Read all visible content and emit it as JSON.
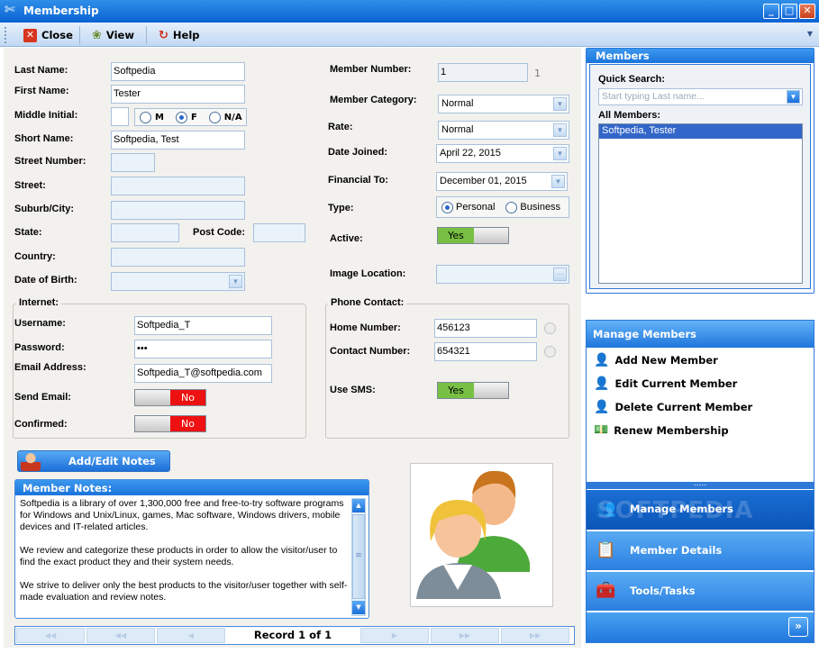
{
  "window": {
    "title": "Membership"
  },
  "toolbar": {
    "close": "Close",
    "view": "View",
    "help": "Help"
  },
  "form": {
    "last_name_label": "Last Name:",
    "last_name": "Softpedia",
    "first_name_label": "First Name:",
    "first_name": "Tester",
    "middle_initial_label": "Middle Initial:",
    "middle_initial": "",
    "gender_m": "M",
    "gender_f": "F",
    "gender_na": "N/A",
    "short_name_label": "Short Name:",
    "short_name": "Softpedia, Test",
    "street_number_label": "Street Number:",
    "street_label": "Street:",
    "suburb_label": "Suburb/City:",
    "state_label": "State:",
    "post_code_label": "Post Code:",
    "country_label": "Country:",
    "dob_label": "Date of Birth:",
    "member_number_label": "Member Number:",
    "member_number": "1",
    "member_number_side": "1",
    "category_label": "Member Category:",
    "category": "Normal",
    "rate_label": "Rate:",
    "rate": "Normal",
    "date_joined_label": "Date Joined:",
    "date_joined": "April 22, 2015",
    "financial_to_label": "Financial To:",
    "financial_to": "December 01, 2015",
    "type_label": "Type:",
    "type_personal": "Personal",
    "type_business": "Business",
    "active_label": "Active:",
    "active": "Yes",
    "image_location_label": "Image Location:"
  },
  "internet": {
    "title": "Internet:",
    "username_label": "Username:",
    "username": "Softpedia_T",
    "password_label": "Password:",
    "password": "•••",
    "email_label": "Email Address:",
    "email": "Softpedia_T@softpedia.com",
    "send_email_label": "Send Email:",
    "send_email": "No",
    "confirmed_label": "Confirmed:",
    "confirmed": "No"
  },
  "phone": {
    "title": "Phone Contact:",
    "home_label": "Home Number:",
    "home": "456123",
    "contact_label": "Contact Number:",
    "contact": "654321",
    "sms_label": "Use SMS:",
    "sms": "Yes"
  },
  "notes": {
    "button": "Add/Edit Notes",
    "title": "Member Notes:",
    "p1": "Softpedia is a library of over 1,300,000 free and free-to-try software programs for Windows and Unix/Linux, games, Mac software, Windows drivers, mobile devices and IT-related articles.",
    "p2": "We review and categorize these products in order to allow the visitor/user to find the exact product they and their system needs.",
    "p3": "We strive to deliver only the best products to the visitor/user together with self-made evaluation and review notes."
  },
  "record": {
    "label": "Record 1 of 1"
  },
  "members": {
    "title": "Members",
    "quick_search_label": "Quick Search:",
    "search_placeholder": "Start typing Last name...",
    "all_label": "All Members:",
    "list": [
      "Softpedia, Tester"
    ]
  },
  "manage": {
    "title": "Manage Members",
    "add": "Add New Member",
    "edit": "Edit Current Member",
    "delete": "Delete Current Member",
    "renew": "Renew Membership",
    "dots": ".....",
    "nav_manage": "Manage Members",
    "nav_details": "Member Details",
    "nav_tools": "Tools/Tasks",
    "watermark": "SOFTPEDIA"
  },
  "colors": {
    "title_bar": "#0a62d4",
    "accent": "#1b74dc",
    "no_toggle": "#ee1111",
    "yes_toggle": "#78c043"
  }
}
